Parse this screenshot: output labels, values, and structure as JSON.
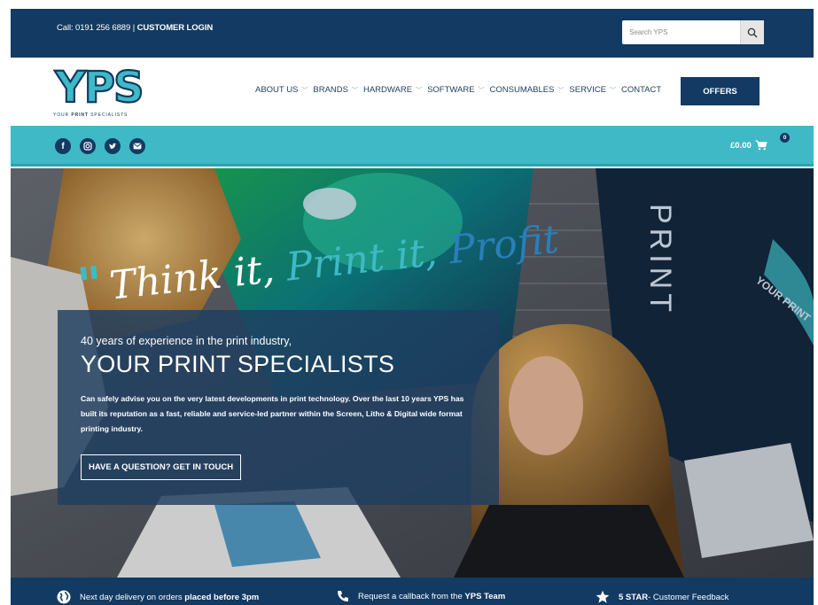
{
  "topbar": {
    "phone": "Call: 0191 256 6889",
    "separator": "|",
    "login": "CUSTOMER LOGIN",
    "search_placeholder": "Search YPS"
  },
  "logo": {
    "text": "YPS",
    "tagline_a": "YOUR ",
    "tagline_b": "PRINT",
    "tagline_c": " SPECIALISTS"
  },
  "nav": {
    "items": [
      {
        "label": "ABOUT US",
        "dropdown": true
      },
      {
        "label": "BRANDS",
        "dropdown": true
      },
      {
        "label": "HARDWARE",
        "dropdown": true
      },
      {
        "label": "SOFTWARE",
        "dropdown": true
      },
      {
        "label": "CONSUMABLES",
        "dropdown": true
      },
      {
        "label": "SERVICE",
        "dropdown": true
      },
      {
        "label": "CONTACT",
        "dropdown": false
      }
    ],
    "offers": "OFFERS"
  },
  "social": {
    "icons": [
      "facebook-icon",
      "instagram-icon",
      "twitter-icon",
      "email-icon"
    ],
    "cart_total": "£0.00",
    "cart_count": "0"
  },
  "hero": {
    "tagline_quote": "\"",
    "tagline_1": "Think it, ",
    "tagline_2": "Print it, ",
    "tagline_3": "Profit",
    "kicker": "40 years of experience in the print industry,",
    "headline": "YOUR PRINT SPECIALISTS",
    "body": "Can safely advise you on the very latest developments in print technology. Over the last 10 years YPS has built its reputation as a fast, reliable and service-led partner within the Screen, Litho & Digital wide format printing industry.",
    "cta": "HAVE A QUESTION? GET IN TOUCH",
    "bg_texts": {
      "stand_print": "PRINT",
      "stand_logo": "YOUR PRINT"
    }
  },
  "features": [
    {
      "icon": "globe-icon",
      "text": "Next day delivery on orders ",
      "bold": "placed before 3pm"
    },
    {
      "icon": "phone-icon",
      "text": "Request a callback from the ",
      "bold": "YPS Team"
    },
    {
      "icon": "star-icon",
      "bold": "5 STAR",
      "text": " - Customer Feedback"
    }
  ],
  "colors": {
    "navy": "#123a63",
    "teal": "#3fb9c6"
  }
}
